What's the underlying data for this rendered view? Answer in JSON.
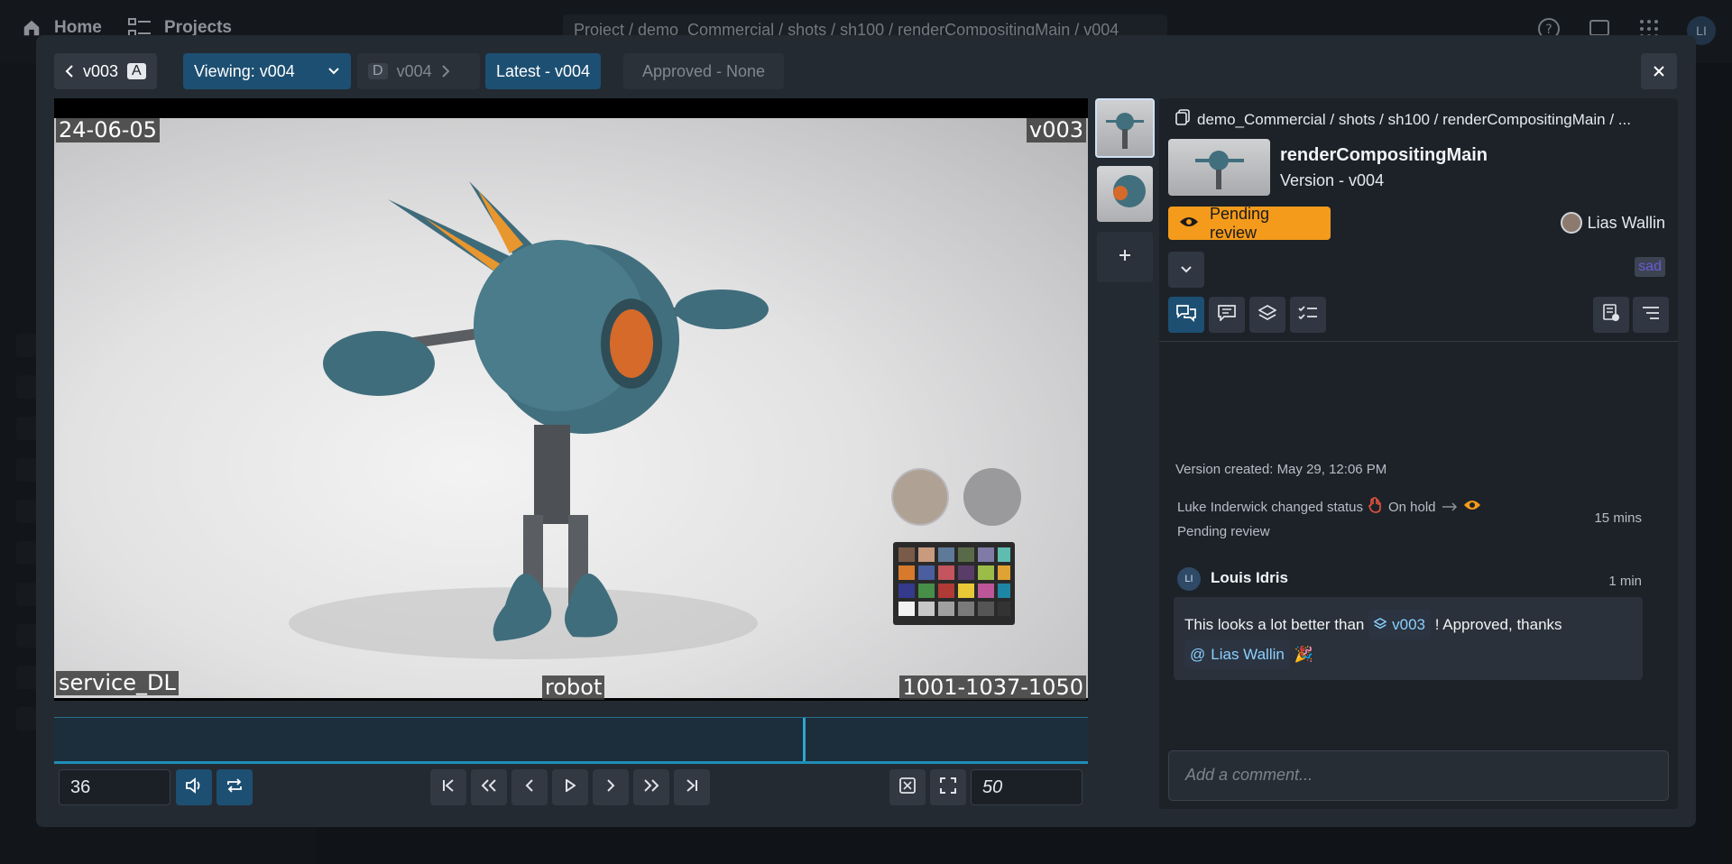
{
  "topbar": {
    "home_label": "Home",
    "projects_label": "Projects",
    "breadcrumb": "Project / demo_Commercial / shots / sh100 / renderCompositingMain / v004",
    "user_initials": "LI"
  },
  "toolbar": {
    "prev_version": "v003",
    "prev_badge": "A",
    "viewing_label": "Viewing: v004",
    "next_badge": "D",
    "next_version": "v004",
    "latest_label": "Latest - v004",
    "approved_label": "Approved - None"
  },
  "viewer": {
    "overlay_date": "24-06-05",
    "overlay_version": "v003",
    "overlay_service": "service_DL",
    "overlay_asset": "robot",
    "overlay_frames": "1001-1037-1050",
    "playhead_fraction": 0.724
  },
  "controls": {
    "frame_value": "36",
    "fps_value": "50"
  },
  "panel": {
    "path": "demo_Commercial / shots / sh100 / renderCompositingMain / ...",
    "product_name": "renderCompositingMain",
    "version_prefix": "Version - ",
    "version_value": "v004",
    "status_label": "Pending review",
    "assignee": "Lias Wallin",
    "tag": "sad",
    "activity": {
      "created": "Version created: May 29, 12:06 PM",
      "status_change_actor": "Luke Inderwick changed status",
      "status_from": "On hold",
      "status_to": "Pending review",
      "status_time": "15 mins",
      "comment_initials": "LI",
      "comment_author": "Louis Idris",
      "comment_time": "1 min",
      "comment_text_1": "This looks a lot better than",
      "comment_version_ref": "v003",
      "comment_text_2": "! Approved, thanks",
      "comment_mention": "Lias Wallin",
      "comment_emoji": "🎉"
    },
    "comment_placeholder": "Add a comment..."
  },
  "colors": {
    "accent_blue": "#1d4f72",
    "status_orange": "#f49b1b",
    "link_blue": "#8ccfff",
    "tag_purple": "#6b5bd6"
  }
}
